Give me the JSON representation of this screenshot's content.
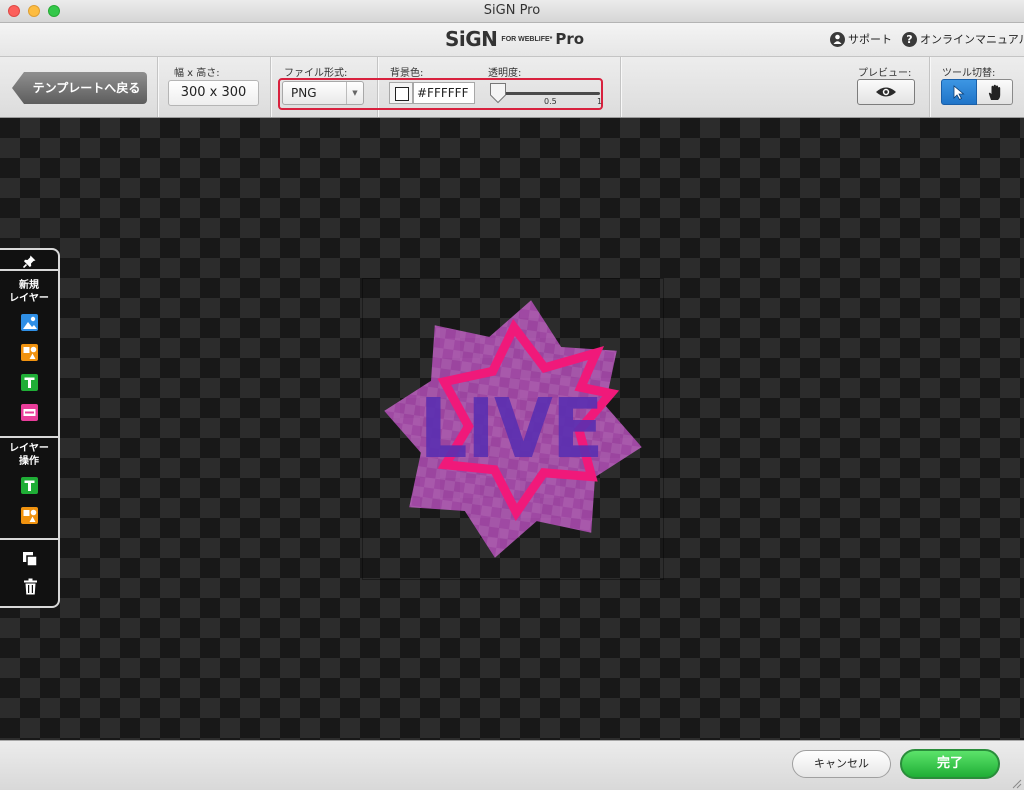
{
  "window": {
    "title": "SiGN Pro"
  },
  "brand": {
    "main": "SiGN",
    "sub": "FOR WEBLIFE*",
    "pro": "Pro"
  },
  "header_links": {
    "support": "サポート",
    "manual": "オンラインマニュアル"
  },
  "toolbar": {
    "back_label": "テンプレートへ戻る",
    "size_label": "幅 x 高さ:",
    "size_value": "300 x 300",
    "format_label": "ファイル形式:",
    "format_value": "PNG",
    "bgcolor_label": "背景色:",
    "bgcolor_value": "#FFFFFF",
    "opacity_label": "透明度:",
    "opacity_value": 0,
    "opacity_tick_mid": "0.5",
    "opacity_tick_max": "1",
    "preview_label": "プレビュー:",
    "tool_label": "ツール切替:"
  },
  "canvas": {
    "art_text": "LIVE"
  },
  "left_panel": {
    "new_layer_title": "新規\nレイヤー",
    "layer_ops_title": "レイヤー\n操作",
    "icons": [
      "pin-icon",
      "image-layer-icon",
      "shape-layer-icon",
      "text-layer-icon",
      "banner-layer-icon",
      "text-edit-icon",
      "shape-edit-icon",
      "duplicate-icon",
      "trash-icon"
    ]
  },
  "bottom": {
    "cancel_label": "キャンセル",
    "done_label": "完了"
  },
  "colors": {
    "highlight": "#d8213e",
    "done_green": "#1fae36",
    "active_tool": "#1f74c8",
    "star_outer": "#b84fbd",
    "star_inner": "#f0197a",
    "art_text": "#5a2fb0"
  }
}
